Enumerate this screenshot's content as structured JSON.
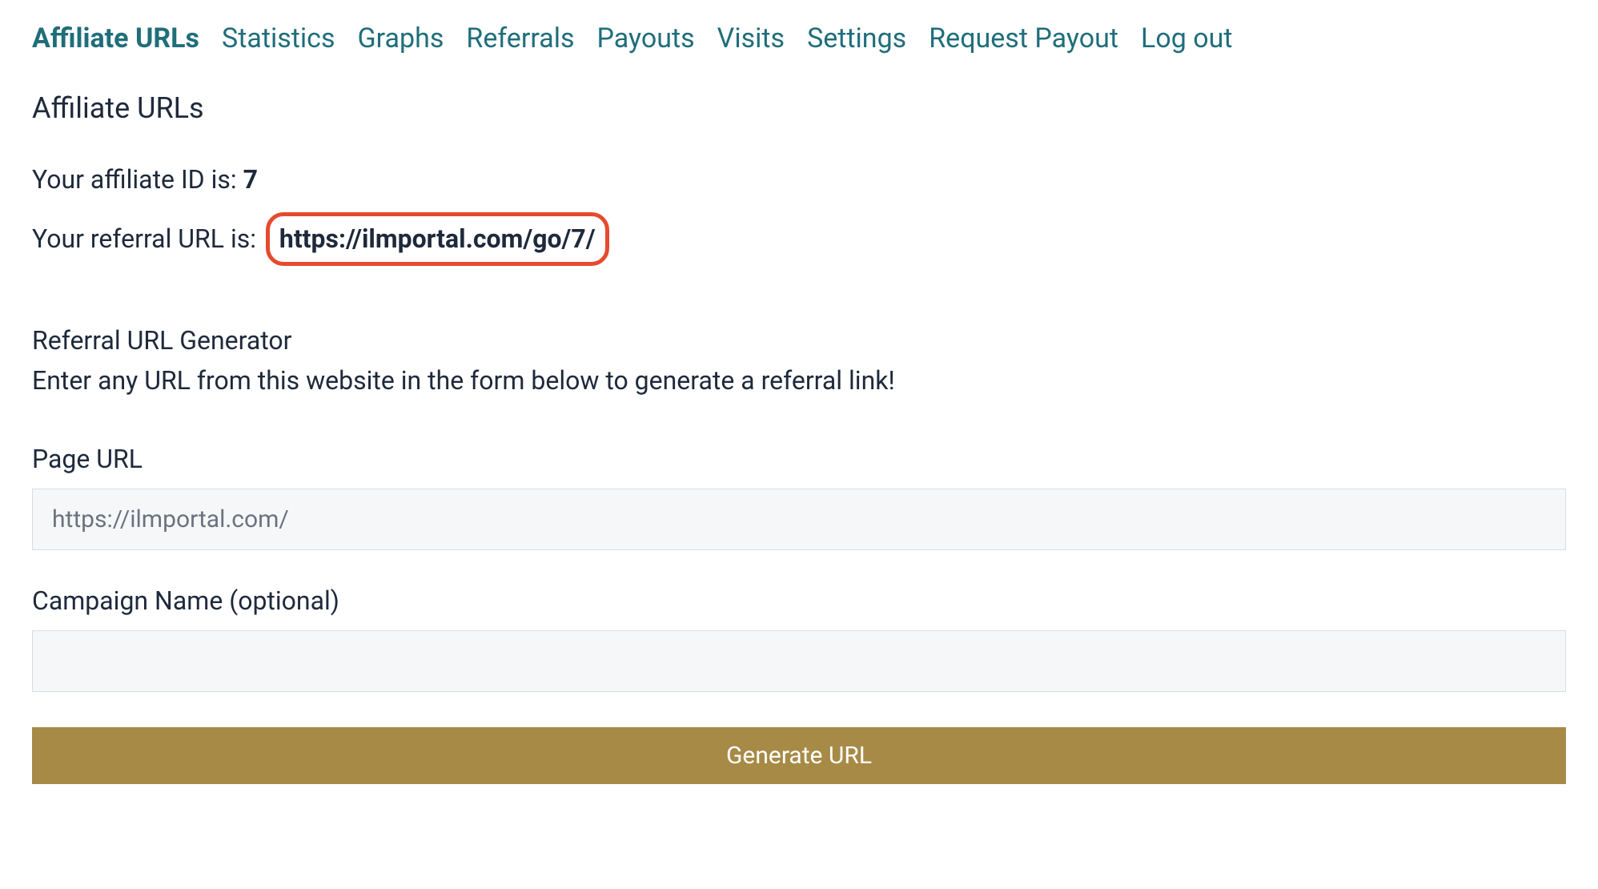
{
  "tabs": [
    {
      "label": "Affiliate URLs",
      "active": true
    },
    {
      "label": "Statistics",
      "active": false
    },
    {
      "label": "Graphs",
      "active": false
    },
    {
      "label": "Referrals",
      "active": false
    },
    {
      "label": "Payouts",
      "active": false
    },
    {
      "label": "Visits",
      "active": false
    },
    {
      "label": "Settings",
      "active": false
    },
    {
      "label": "Request Payout",
      "active": false
    },
    {
      "label": "Log out",
      "active": false
    }
  ],
  "page_title": "Affiliate URLs",
  "affiliate_id_label": "Your affiliate ID is: ",
  "affiliate_id_value": "7",
  "referral_url_label": "Your referral URL is: ",
  "referral_url_value": "https://ilmportal.com/go/7/",
  "generator_heading": "Referral URL Generator",
  "generator_desc": "Enter any URL from this website in the form below to generate a referral link!",
  "page_url_label": "Page URL",
  "page_url_value": "https://ilmportal.com/",
  "campaign_label": "Campaign Name (optional)",
  "campaign_value": "",
  "generate_button_label": "Generate URL",
  "colors": {
    "tab": "#1f6e7a",
    "highlight_border": "#e64a2e",
    "button_bg": "#a78a46"
  }
}
